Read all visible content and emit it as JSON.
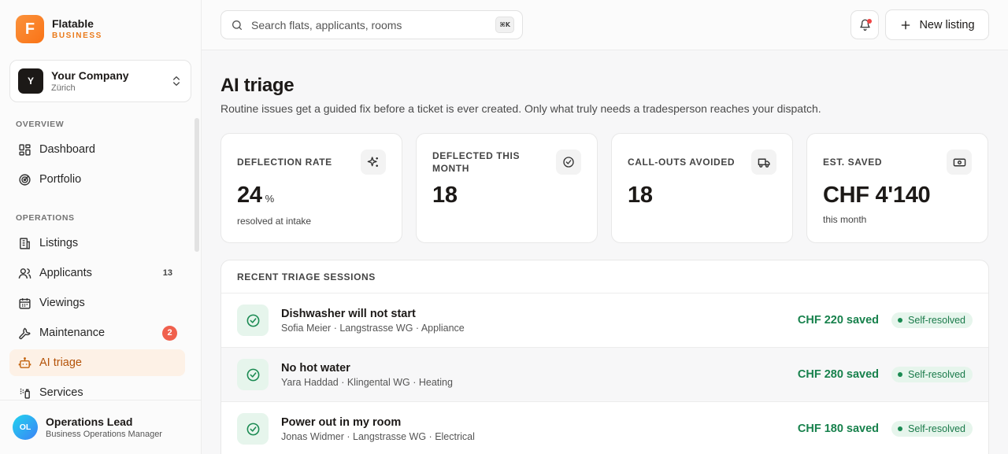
{
  "brand": {
    "logo_letter": "F",
    "name": "Flatable",
    "subtitle": "BUSINESS"
  },
  "company": {
    "avatar": "Y",
    "name": "Your Company",
    "city": "Zürich"
  },
  "nav": {
    "overview_label": "OVERVIEW",
    "operations_label": "OPERATIONS",
    "items": [
      {
        "label": "Dashboard",
        "icon": "dashboard-icon"
      },
      {
        "label": "Portfolio",
        "icon": "portfolio-icon"
      },
      {
        "label": "Listings",
        "icon": "building-icon"
      },
      {
        "label": "Applicants",
        "icon": "users-icon",
        "count": "13"
      },
      {
        "label": "Viewings",
        "icon": "calendar-icon"
      },
      {
        "label": "Maintenance",
        "icon": "wrench-icon",
        "badge": "2"
      },
      {
        "label": "AI triage",
        "icon": "bot-icon",
        "active": true
      },
      {
        "label": "Services",
        "icon": "services-icon"
      }
    ]
  },
  "user": {
    "initials": "OL",
    "name": "Operations Lead",
    "role": "Business Operations Manager"
  },
  "search": {
    "placeholder": "Search flats, applicants, rooms",
    "shortcut": "⌘K"
  },
  "topbar": {
    "new_listing_label": "New listing"
  },
  "page": {
    "title": "AI triage",
    "description": "Routine issues get a guided fix before a ticket is ever created. Only what truly needs a tradesperson reaches your dispatch."
  },
  "kpis": [
    {
      "label": "DEFLECTION RATE",
      "value": "24",
      "unit": "%",
      "sub": "resolved at intake",
      "icon": "sparkles-icon"
    },
    {
      "label": "DEFLECTED THIS MONTH",
      "value": "18",
      "sub": "",
      "icon": "check-circle-icon"
    },
    {
      "label": "CALL-OUTS AVOIDED",
      "value": "18",
      "sub": "",
      "icon": "truck-icon"
    },
    {
      "label": "EST. SAVED",
      "value": "CHF 4'140",
      "sub": "this month",
      "icon": "banknote-icon"
    }
  ],
  "sessions": {
    "title": "RECENT TRIAGE SESSIONS",
    "rows": [
      {
        "title": "Dishwasher will not start",
        "meta": "Sofia Meier · Langstrasse WG · Appliance",
        "saved": "CHF 220 saved",
        "status": "Self-resolved"
      },
      {
        "title": "No hot water",
        "meta": "Yara Haddad · Klingental WG · Heating",
        "saved": "CHF 280 saved",
        "status": "Self-resolved"
      },
      {
        "title": "Power out in my room",
        "meta": "Jonas Widmer · Langstrasse WG · Electrical",
        "saved": "CHF 180 saved",
        "status": "Self-resolved"
      }
    ]
  },
  "colors": {
    "accent": "#f97316",
    "success": "#17814c",
    "badge": "#f0604d"
  }
}
